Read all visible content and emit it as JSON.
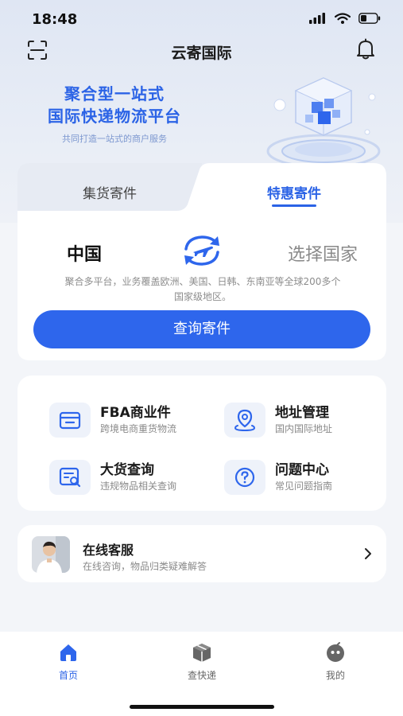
{
  "status_bar": {
    "time": "18:48"
  },
  "header": {
    "title": "云寄国际"
  },
  "hero": {
    "line1": "聚合型一站式",
    "line2": "国际快递物流平台",
    "subtitle": "共同打造一站式的商户服务"
  },
  "send": {
    "tabs": [
      {
        "label": "集货寄件",
        "active": false
      },
      {
        "label": "特惠寄件",
        "active": true
      }
    ],
    "origin": "中国",
    "destination_placeholder": "选择国家",
    "description": "聚合多平台，业务覆盖欧洲、美国、日韩、东南亚等全球200多个国家级地区。",
    "query_button": "查询寄件"
  },
  "services": [
    {
      "title": "FBA商业件",
      "subtitle": "跨境电商重货物流",
      "icon": "fba-box-icon"
    },
    {
      "title": "地址管理",
      "subtitle": "国内国际地址",
      "icon": "location-pin-icon"
    },
    {
      "title": "大货查询",
      "subtitle": "违规物品相关查询",
      "icon": "search-document-icon"
    },
    {
      "title": "问题中心",
      "subtitle": "常见问题指南",
      "icon": "question-mark-icon"
    }
  ],
  "customer_service": {
    "title": "在线客服",
    "subtitle": "在线咨询，物品归类疑难解答"
  },
  "tab_bar": [
    {
      "label": "首页",
      "icon": "home-icon",
      "active": true
    },
    {
      "label": "查快递",
      "icon": "package-icon",
      "active": false
    },
    {
      "label": "我的",
      "icon": "profile-face-icon",
      "active": false
    }
  ],
  "colors": {
    "accent": "#2e66ec",
    "background": "#f3f5f9"
  }
}
